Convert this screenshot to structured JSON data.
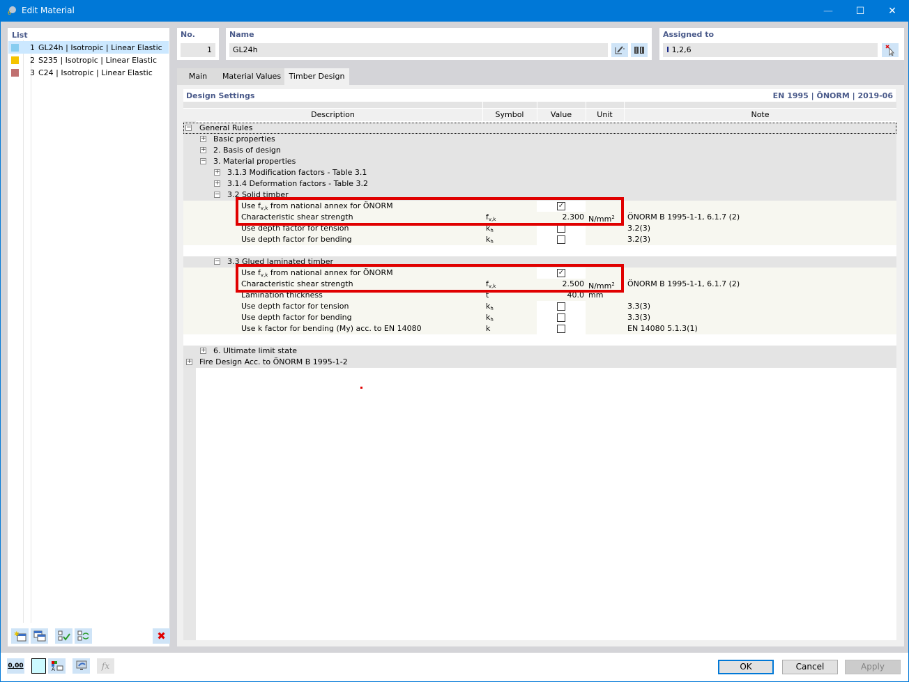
{
  "window": {
    "title": "Edit Material",
    "minimize": "—",
    "maximize": "☐",
    "close": "✕"
  },
  "list": {
    "label": "List",
    "items": [
      {
        "num": "1",
        "text": "GL24h | Isotropic | Linear Elastic",
        "color": "#87cdf0",
        "selected": true
      },
      {
        "num": "2",
        "text": "S235 | Isotropic | Linear Elastic",
        "color": "#f5c400",
        "selected": false
      },
      {
        "num": "3",
        "text": "C24 | Isotropic | Linear Elastic",
        "color": "#c07070",
        "selected": false
      }
    ],
    "toolbar": {
      "new": "new-material",
      "copy": "copy-material",
      "check": "check-all",
      "check_swap": "check-swap",
      "delete": "✖"
    }
  },
  "fields": {
    "no_label": "No.",
    "no_value": "1",
    "name_label": "Name",
    "name_value": "GL24h",
    "assigned_label": "Assigned to",
    "assigned_value": "1,2,6",
    "assigned_icon": "I"
  },
  "tabs": [
    {
      "label": "Main",
      "active": false
    },
    {
      "label": "Material Values",
      "active": false
    },
    {
      "label": "Timber Design",
      "active": true
    }
  ],
  "design": {
    "title": "Design Settings",
    "standard": "EN 1995 | ÖNORM | 2019-06",
    "columns": {
      "description": "Description",
      "symbol": "Symbol",
      "value": "Value",
      "unit": "Unit",
      "note": "Note"
    },
    "rows": {
      "general_rules": "General Rules",
      "basic_properties": "Basic properties",
      "basis_of_design": "2. Basis of design",
      "material_properties": "3. Material properties",
      "modification_factors": "3.1.3 Modification factors - Table 3.1",
      "deformation_factors": "3.1.4 Deformation factors - Table 3.2",
      "solid_timber": "3.2 Solid timber",
      "glulam": "3.3 Glued laminated timber",
      "uls": "6. Ultimate limit state",
      "fire": "Fire Design Acc. to ÖNORM B 1995-1-2"
    },
    "solid": {
      "use_fvk_pre": "Use f",
      "use_fvk_sub": "v,k",
      "use_fvk_post": " from national annex for ÖNORM",
      "use_fvk_checked": true,
      "shear_label": "Characteristic shear strength",
      "shear_sym": "f",
      "shear_sym_sub": "v,k",
      "shear_value": "2.300",
      "shear_unit": "N/mm",
      "shear_unit_sup": "2",
      "shear_note": "ÖNORM B 1995-1-1, 6.1.7 (2)",
      "tension_label": "Use depth factor for tension",
      "tension_sym": "k",
      "tension_sym_sub": "h",
      "tension_checked": false,
      "tension_note": "3.2(3)",
      "bending_label": "Use depth factor for bending",
      "bending_sym": "k",
      "bending_sym_sub": "h",
      "bending_checked": false,
      "bending_note": "3.2(3)"
    },
    "glulam_rows": {
      "use_fvk_pre": "Use f",
      "use_fvk_sub": "v,k",
      "use_fvk_post": " from national annex for ÖNORM",
      "use_fvk_checked": true,
      "shear_label": "Characteristic shear strength",
      "shear_sym": "f",
      "shear_sym_sub": "v,k",
      "shear_value": "2.500",
      "shear_unit": "N/mm",
      "shear_unit_sup": "2",
      "shear_note": "ÖNORM B 1995-1-1, 6.1.7 (2)",
      "lam_label": "Lamination thickness",
      "lam_sym": "t",
      "lam_value": "40.0",
      "lam_unit": "mm",
      "tension_label": "Use depth factor for tension",
      "tension_sym": "k",
      "tension_sym_sub": "h",
      "tension_checked": false,
      "tension_note": "3.3(3)",
      "bending_label": "Use depth factor for bending",
      "bending_sym": "k",
      "bending_sym_sub": "h",
      "bending_checked": false,
      "bending_note": "3.3(3)",
      "kfactor_label": "Use k factor for bending (My) acc. to EN 14080",
      "kfactor_sym": "k",
      "kfactor_checked": false,
      "kfactor_note": "EN 14080 5.1.3(1)"
    }
  },
  "buttons": {
    "ok": "OK",
    "cancel": "Cancel",
    "apply": "Apply"
  },
  "bottom_tools": {
    "units": "0,00"
  }
}
